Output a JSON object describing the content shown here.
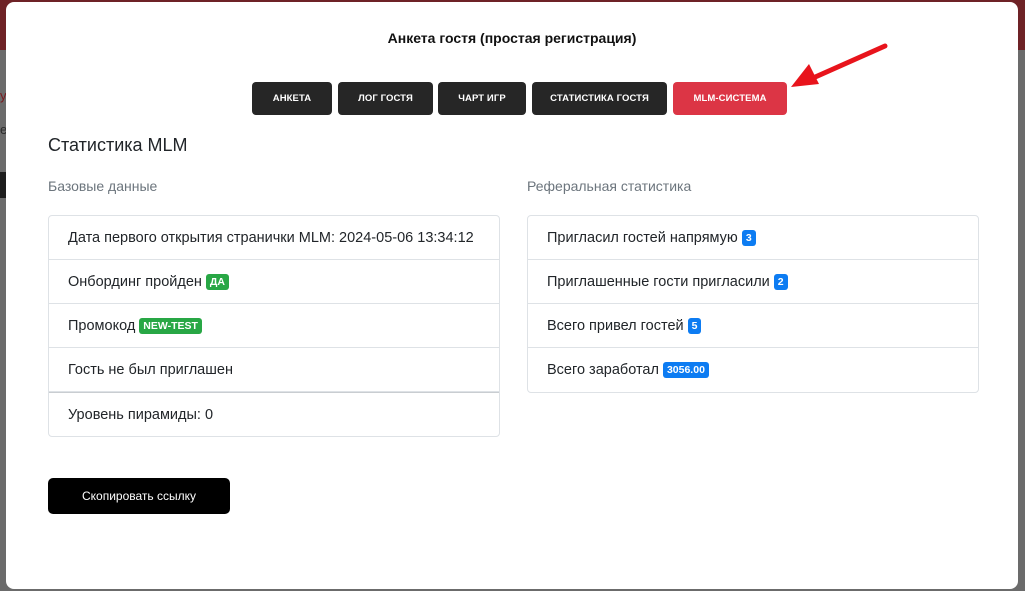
{
  "modal": {
    "title": "Анкета гостя (простая регистрация)"
  },
  "tabs": [
    {
      "label": "АНКЕТА"
    },
    {
      "label": "ЛОГ ГОСТЯ"
    },
    {
      "label": "ЧАРТ ИГР"
    },
    {
      "label": "СТАТИСТИКА ГОСТЯ"
    },
    {
      "label": "MLM-СИСТЕМА",
      "active": true
    }
  ],
  "section_title": "Статистика MLM",
  "base": {
    "heading": "Базовые данные",
    "first_open": "Дата первого открытия странички MLM: 2024-05-06 13:34:12",
    "onboarding_label": "Онбординг пройден",
    "onboarding_badge": "ДА",
    "promo_label": "Промокод",
    "promo_badge": "NEW-TEST",
    "invited_status": "Гость не был приглашен",
    "pyramid_level": "Уровень пирамиды: 0"
  },
  "referral": {
    "heading": "Реферальная статистика",
    "direct_label": "Пригласил гостей напрямую",
    "direct_value": "3",
    "second_label": "Приглашенные гости пригласили",
    "second_value": "2",
    "total_label": "Всего привел гостей",
    "total_value": "5",
    "earned_label": "Всего заработал",
    "earned_value": "3056.00"
  },
  "copy_button": "Скопировать ссылку",
  "colors": {
    "active_tab": "#dc3545",
    "tab": "#262626",
    "badge_green": "#28a745",
    "badge_blue": "#0d7cf2",
    "arrow": "#e8141c"
  },
  "background_letters": [
    "у",
    "е"
  ]
}
